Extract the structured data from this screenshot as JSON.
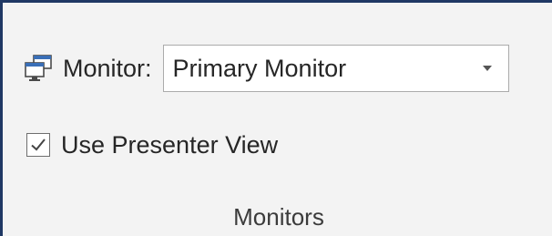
{
  "group": {
    "title": "Monitors"
  },
  "monitor": {
    "label": "Monitor:",
    "selected": "Primary Monitor",
    "icon": "monitor-icon"
  },
  "presenter_view": {
    "label": "Use Presenter View",
    "checked": true
  },
  "colors": {
    "frame_border": "#1f3864",
    "panel_background": "#f3f3f3"
  }
}
